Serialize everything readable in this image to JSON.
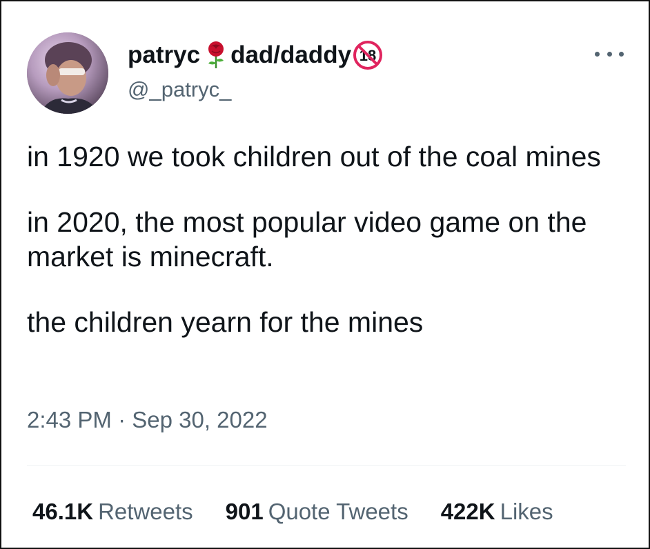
{
  "user": {
    "display_name_first": "patryc",
    "rose_emoji": "rose-icon",
    "display_name_second": "dad/daddy",
    "badge_icon": "no-under-18-icon",
    "badge_text": "18",
    "handle": "@_patryc_"
  },
  "tweet": {
    "paragraphs": [
      "in 1920 we took children out of the coal mines",
      "in 2020, the most popular video game on the market is minecraft.",
      "the children yearn for the mines"
    ],
    "timestamp": "2:43 PM · Sep 30, 2022"
  },
  "stats": {
    "retweets_count": "46.1K",
    "retweets_label": "Retweets",
    "quotes_count": "901",
    "quotes_label": "Quote Tweets",
    "likes_count": "422K",
    "likes_label": "Likes"
  },
  "colors": {
    "text_primary": "#0f1419",
    "text_secondary": "#536471",
    "divider": "#eff3f4",
    "badge_red": "#e0245e"
  }
}
